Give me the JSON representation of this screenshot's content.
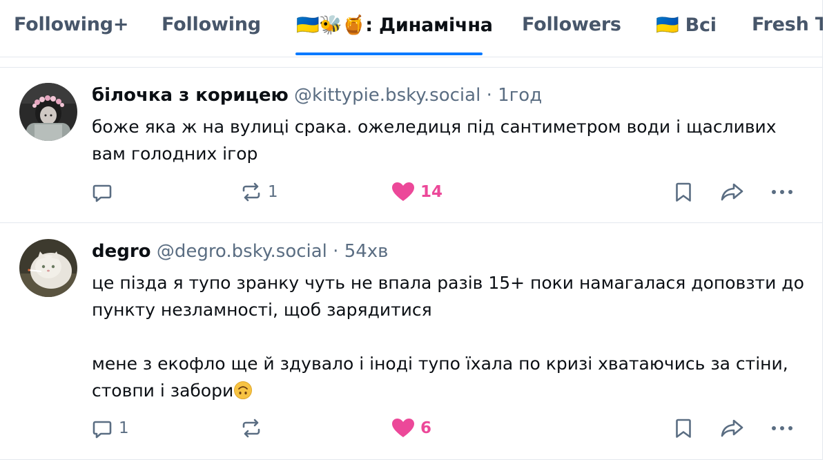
{
  "tabs": [
    {
      "label": "Following+",
      "active": false
    },
    {
      "label": "Following",
      "active": false
    },
    {
      "label": "🇺🇦🐝🍯: Динамічна",
      "active": true
    },
    {
      "label": "Followers",
      "active": false
    },
    {
      "label": "🇺🇦 Всі",
      "active": false
    },
    {
      "label": "Fresh T",
      "active": false
    }
  ],
  "colors": {
    "accent": "#0a7aff",
    "like": "#ec4899",
    "muted": "#5a6d82",
    "text": "#0b0f14",
    "border": "#e3e8ee"
  },
  "posts": [
    {
      "author": "білочка з корицею",
      "handle": "@kittypie.bsky.social",
      "separator": "·",
      "time": "1год",
      "text": "боже яка ж на вулиці срака. ожеледиця під сантиметром води і щасливих вам голодних ігор",
      "reply_count": "",
      "repost_count": "1",
      "like_count": "14",
      "liked": true,
      "avatar_icon": "avatar-flower-crown"
    },
    {
      "author": "degro",
      "handle": "@degro.bsky.social",
      "separator": "·",
      "time": "54хв",
      "text_line1": "це пізда я тупо зранку чуть не впала разів 15+ поки намагалася доповзти до пункту незламності, щоб зарядитися",
      "text_line2": "мене з екофло ще й здувало і іноді тупо їхала по кризі хватаючись за стіни, стовпи і забори",
      "reply_count": "1",
      "repost_count": "",
      "like_count": "6",
      "liked": true,
      "avatar_icon": "avatar-white-cat",
      "emoji": "upside-down-face-emoji"
    }
  ],
  "icons": {
    "reply": "reply-icon",
    "repost": "repost-icon",
    "like": "heart-icon",
    "bookmark": "bookmark-icon",
    "share": "share-icon",
    "more": "more-icon"
  }
}
